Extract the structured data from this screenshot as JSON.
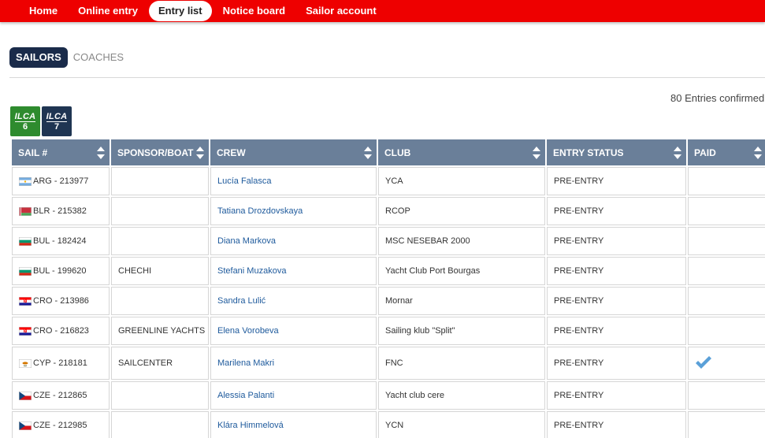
{
  "nav": {
    "items": [
      {
        "label": "Home",
        "active": false
      },
      {
        "label": "Online entry",
        "active": false
      },
      {
        "label": "Entry list",
        "active": true
      },
      {
        "label": "Notice board",
        "active": false
      },
      {
        "label": "Sailor account",
        "active": false
      }
    ]
  },
  "tabs": {
    "sailors": "SAILORS",
    "coaches": "COACHES"
  },
  "entries_count": "80 Entries confirmed",
  "classes": [
    {
      "name": "ILCA",
      "size": "6",
      "color": "#2e8b2e"
    },
    {
      "name": "ILCA",
      "size": "7",
      "color": "#1f3552"
    }
  ],
  "table": {
    "headers": [
      "SAIL #",
      "SPONSOR/BOAT",
      "CREW",
      "CLUB",
      "ENTRY STATUS",
      "PAID"
    ],
    "rows": [
      {
        "sail": "ARG - 213977",
        "flag": "arg-flag",
        "sponsor": "",
        "crew": "Lucía Falasca",
        "club": "YCA",
        "status": "PRE-ENTRY",
        "paid": false
      },
      {
        "sail": "BLR - 215382",
        "flag": "blr-flag",
        "sponsor": "",
        "crew": "Tatiana Drozdovskaya",
        "club": "RCOP",
        "status": "PRE-ENTRY",
        "paid": false
      },
      {
        "sail": "BUL - 182424",
        "flag": "bul-flag",
        "sponsor": "",
        "crew": "Diana Markova",
        "club": "MSC NESEBAR 2000",
        "status": "PRE-ENTRY",
        "paid": false
      },
      {
        "sail": "BUL - 199620",
        "flag": "bul-flag",
        "sponsor": "CHECHI",
        "crew": "Stefani Muzakova",
        "club": "Yacht Club Port Bourgas",
        "status": "PRE-ENTRY",
        "paid": false
      },
      {
        "sail": "CRO - 213986",
        "flag": "cro-flag",
        "sponsor": "",
        "crew": "Sandra Lulić",
        "club": "Mornar",
        "status": "PRE-ENTRY",
        "paid": false
      },
      {
        "sail": "CRO - 216823",
        "flag": "cro-flag",
        "sponsor": "GREENLINE YACHTS",
        "crew": "Elena Vorobeva",
        "club": "Sailing klub \"Split\"",
        "status": "PRE-ENTRY",
        "paid": false
      },
      {
        "sail": "CYP - 218181",
        "flag": "cyp-flag",
        "sponsor": "SAILCENTER",
        "crew": "Marilena Makri",
        "club": "FNC",
        "status": "PRE-ENTRY",
        "paid": true
      },
      {
        "sail": "CZE - 212865",
        "flag": "cze-flag",
        "sponsor": "",
        "crew": "Alessia Palanti",
        "club": "Yacht club cere",
        "status": "PRE-ENTRY",
        "paid": false
      },
      {
        "sail": "CZE - 212985",
        "flag": "cze-flag",
        "sponsor": "",
        "crew": "Klára Himmelová",
        "club": "YCN",
        "status": "PRE-ENTRY",
        "paid": false
      }
    ]
  },
  "colors": {
    "nav_bg": "#ee0000",
    "header_bg": "#6a7f99",
    "active_tab_bg": "#1a2b4a",
    "link": "#1e5a9c",
    "check": "#5aa0d8"
  }
}
